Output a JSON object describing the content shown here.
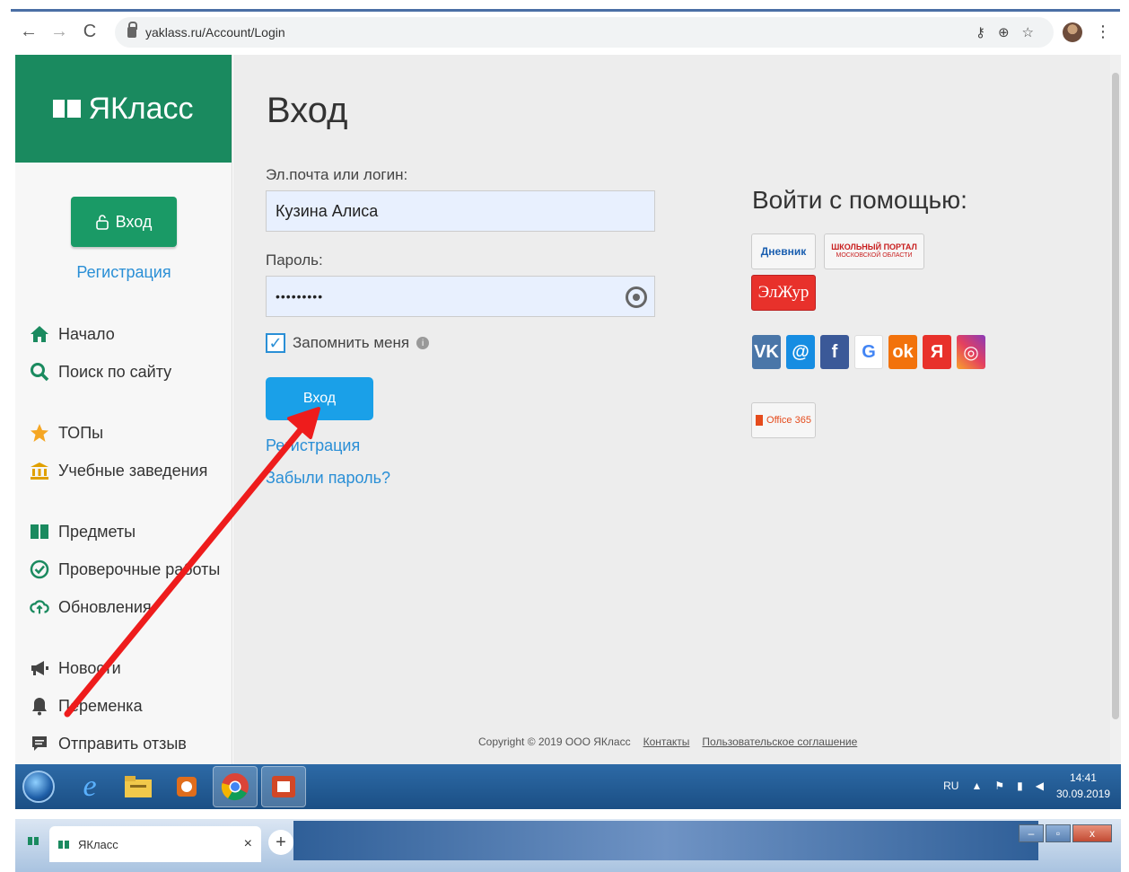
{
  "browser": {
    "url": "yaklass.ru/Account/Login",
    "back": "←",
    "forward": "→",
    "reload": "C",
    "key_icon": "⚷",
    "plus_icon": "⊕",
    "star_icon": "☆",
    "menu_icon": "⋮"
  },
  "sidebar": {
    "logo": "ЯКласс",
    "login_button": "Вход",
    "register_link": "Регистрация",
    "items": [
      {
        "label": "Начало",
        "icon": "home-icon",
        "color": "#1a8a5f"
      },
      {
        "label": "Поиск по сайту",
        "icon": "search-icon",
        "color": "#1a8a5f"
      },
      {
        "label": "ТОПы",
        "icon": "star-icon",
        "color": "#f5a623"
      },
      {
        "label": "Учебные заведения",
        "icon": "institution-icon",
        "color": "#e0a000"
      },
      {
        "label": "Предметы",
        "icon": "book-icon",
        "color": "#1a8a5f"
      },
      {
        "label": "Проверочные работы",
        "icon": "check-icon",
        "color": "#1a8a5f"
      },
      {
        "label": "Обновления",
        "icon": "cloud-update-icon",
        "color": "#1a8a5f"
      },
      {
        "label": "Новости",
        "icon": "megaphone-icon",
        "color": "#444"
      },
      {
        "label": "Переменка",
        "icon": "bell-icon",
        "color": "#444"
      },
      {
        "label": "Отправить отзыв",
        "icon": "feedback-icon",
        "color": "#444"
      }
    ]
  },
  "main": {
    "title": "Вход",
    "login_label": "Эл.почта или логин:",
    "login_value": "Кузина Алиса",
    "password_label": "Пароль:",
    "password_value": "•••••••••",
    "remember_label": "Запомнить меня",
    "submit_label": "Вход",
    "register_link": "Регистрация",
    "forgot_link": "Забыли пароль?",
    "oauth_title": "Войти с помощью:",
    "partners": {
      "dnevnik": "Дневник",
      "portal_line1": "ШКОЛЬНЫЙ ПОРТАЛ",
      "portal_line2": "МОСКОВСКОЙ ОБЛАСТИ",
      "elzhur": "ЭлЖур",
      "office": "Office 365"
    },
    "social": [
      {
        "label": "vk",
        "color": "#4a76a8"
      },
      {
        "label": "@",
        "color": "#168de2"
      },
      {
        "label": "f",
        "color": "#3b5998"
      },
      {
        "label": "G",
        "color": "#ffffff"
      },
      {
        "label": "ok",
        "color": "#f2720c"
      },
      {
        "label": "Я",
        "color": "#e8312b"
      },
      {
        "label": "ig",
        "color": "#e4405f"
      }
    ],
    "footer": {
      "copyright": "Copyright © 2019 ООО ЯКласс",
      "contacts": "Контакты",
      "agreement": "Пользовательское соглашение"
    }
  },
  "taskbar": {
    "lang": "RU",
    "time": "14:41",
    "date": "30.09.2019"
  },
  "bottom_tab": {
    "title": "ЯКласс",
    "close": "×",
    "new_tab": "+"
  }
}
